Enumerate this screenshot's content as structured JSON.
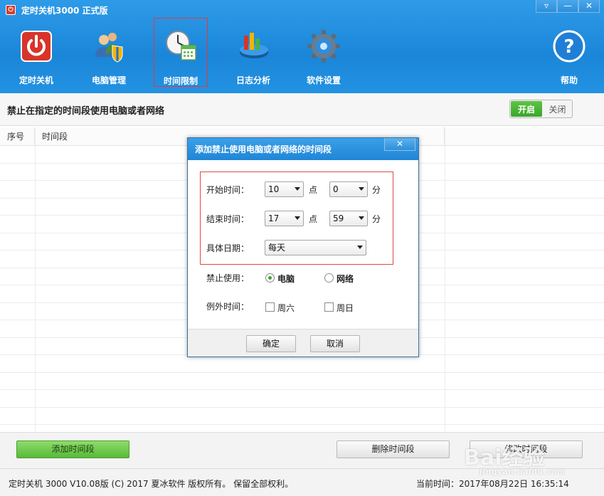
{
  "app": {
    "title": "定时关机3000 正式版",
    "window_controls": [
      "▿",
      "—",
      "✕"
    ]
  },
  "nav": {
    "items": [
      {
        "label": "定时关机",
        "icon": "power-icon"
      },
      {
        "label": "电脑管理",
        "icon": "users-shield-icon"
      },
      {
        "label": "时间限制",
        "icon": "clock-calendar-icon",
        "selected": true
      },
      {
        "label": "日志分析",
        "icon": "chart-icon"
      },
      {
        "label": "软件设置",
        "icon": "gear-icon"
      }
    ],
    "help_label": "帮助"
  },
  "panel": {
    "subtitle": "禁止在指定的时间段使用电脑或者网络",
    "toggle_on": "开启",
    "toggle_off": "关闭"
  },
  "table": {
    "headers": [
      "序号",
      "时间段"
    ]
  },
  "buttons": {
    "add": "添加时间段",
    "delete": "删除时间段",
    "modify": "修改时间段"
  },
  "status": {
    "copyright": "定时关机 3000 V10.08版 (C) 2017  夏冰软件 版权所有。 保留全部权利。",
    "current_time": "当前时间：2017年08月22日 16:35:14"
  },
  "watermark": {
    "text": "Bai经验",
    "sub": "jingyan.baidu.com"
  },
  "dialog": {
    "title": "添加禁止使用电脑或者网络的时间段",
    "close": "✕",
    "start_label": "开始时间：",
    "start_hour": "10",
    "start_minute": "0",
    "end_label": "结束时间：",
    "end_hour": "17",
    "end_minute": "59",
    "hour_unit": "点",
    "minute_unit": "分",
    "date_label": "具体日期：",
    "date_value": "每天",
    "forbid_label": "禁止使用：",
    "forbid_options": [
      "电脑",
      "网络"
    ],
    "forbid_selected": "电脑",
    "except_label": "例外时间：",
    "except_options": [
      "周六",
      "周日"
    ],
    "ok": "确定",
    "cancel": "取消"
  }
}
